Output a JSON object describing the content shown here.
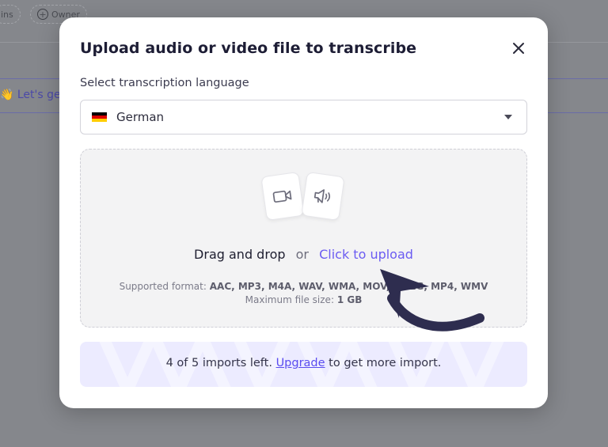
{
  "background": {
    "chips": [
      {
        "label": "ins"
      },
      {
        "label": "Owner"
      }
    ],
    "band_text": "👋 Let's ge"
  },
  "modal": {
    "title": "Upload audio or video file to transcribe",
    "close_icon": "close-icon",
    "language": {
      "label": "Select transcription language",
      "selected": "German",
      "flag_colors": [
        "#000000",
        "#dd0000",
        "#ffce00"
      ]
    },
    "dropzone": {
      "drag_text": "Drag and drop",
      "or_text": "or",
      "upload_link": "Click to upload",
      "formats_label": "Supported format:",
      "formats_value": "AAC, MP3, M4A, WAV, WMA, MOV, MPEG, MP4, WMV",
      "maxsize_label": "Maximum file size:",
      "maxsize_value": "1 GB",
      "icons": [
        "video-camera-icon",
        "speaker-icon"
      ]
    },
    "imports": {
      "count_text": "4 of 5 imports left.",
      "upgrade_link": "Upgrade",
      "suffix": "to get more import."
    }
  },
  "colors": {
    "accent": "#6b5cf2",
    "title": "#1d1d35",
    "arrow": "#2e2d4f",
    "banner_bg": "#ecebff"
  }
}
